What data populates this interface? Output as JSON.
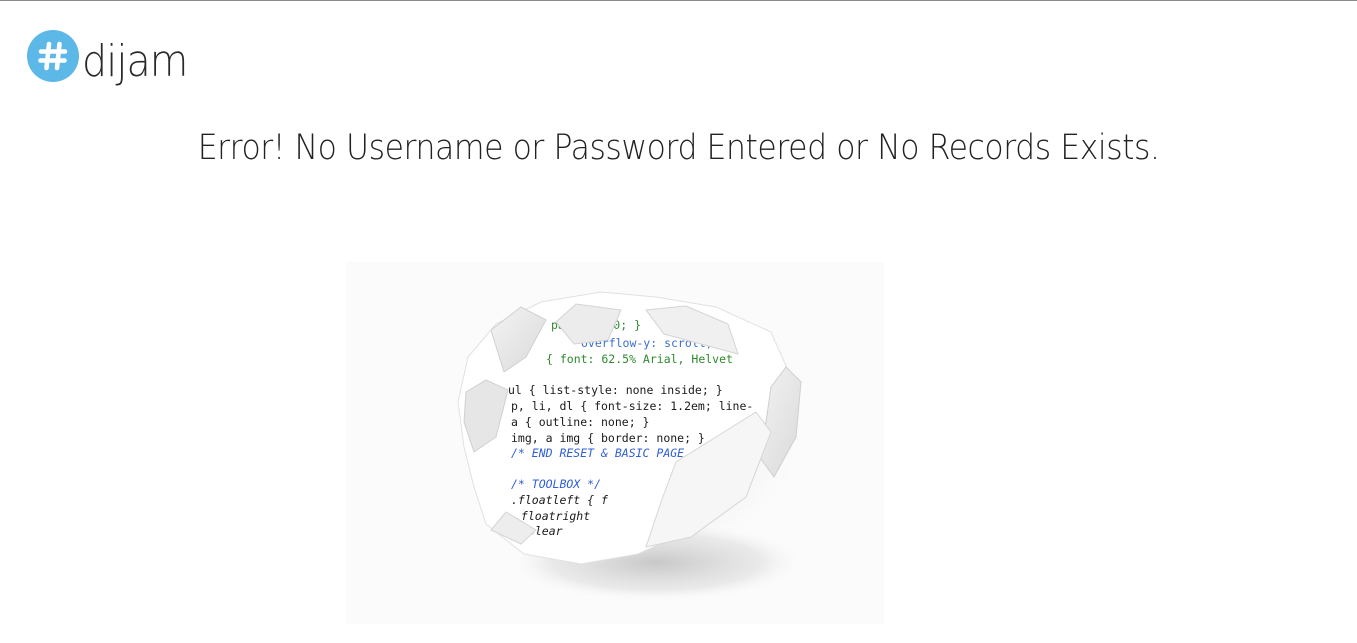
{
  "logo": {
    "badge_symbol": "#",
    "wordmark": "dijam",
    "badge_color": "#5cb8e6"
  },
  "message": {
    "text": "Error! No Username or Password Entered or No Records Exists."
  },
  "illustration": {
    "code_lines": [
      "padding: 0; }",
      "overflow-y: scroll; }",
      "{ font: 62.5% Arial, Helvet",
      "",
      "ul { list-style: none inside; }",
      "p, li, dl { font-size: 1.2em; line-",
      "a { outline: none; }",
      "img, a img { border: none; }",
      "/* END RESET & BASIC PAGE",
      "",
      "/* TOOLBOX */",
      ".floatleft { f",
      ".floatright",
      ".clear"
    ],
    "colors": {
      "selector": "#1a1a1a",
      "property": "#3b6fd1",
      "value": "#2d8a2d",
      "comment": "#2f5fd6",
      "paper": "#ffffff",
      "shadow": "#cfcfcf"
    }
  }
}
